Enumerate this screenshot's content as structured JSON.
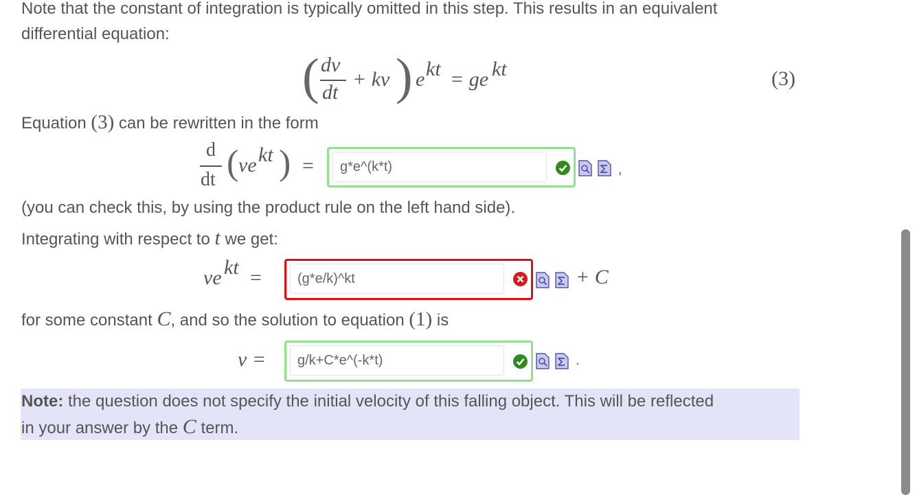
{
  "text": {
    "intro_line1": "Note that the constant of integration is typically omitted in this step. This results in an equivalent",
    "intro_line2": "differential equation:",
    "eq_number": "(3)",
    "equation_ref_prefix": "Equation",
    "equation_ref_num": "(3)",
    "equation_ref_suffix": "can be rewritten in the form",
    "check_note": "(you can check this, by using the product rule on the left hand side).",
    "integrating_prefix": "Integrating with respect to",
    "integrating_var": "t",
    "integrating_suffix": "we get:",
    "constant_prefix": "for some constant",
    "constant_var": "C",
    "constant_mid": ", and so the solution to equation",
    "constant_ref": "(1)",
    "constant_suffix": "is",
    "note_bold": "Note:",
    "note_line1": "the question does not specify the initial velocity of this falling object. This will be reflected",
    "note_line2_prefix": "in your answer by the",
    "note_line2_var": "C",
    "note_line2_suffix": "term."
  },
  "math": {
    "dv": "dv",
    "dt": "dt",
    "plus_kv": "+ kv",
    "e": "e",
    "kt": "kt",
    "equals_ge": "= ge",
    "d": "d",
    "ve": "ve",
    "equals": "=",
    "plus_C": "+ C",
    "v_equals": "v =",
    "comma": ",",
    "period": "."
  },
  "inputs": [
    {
      "value": "g*e^(k*t)",
      "status": "correct"
    },
    {
      "value": "(g*e/k)^kt",
      "status": "incorrect"
    },
    {
      "value": "g/k+C*e^(-k*t)",
      "status": "correct"
    }
  ],
  "icons": [
    "check-circle-icon",
    "cross-circle-icon",
    "preview-doc-icon",
    "sigma-doc-icon"
  ],
  "colors": {
    "correct_border": "#90e090",
    "incorrect_border": "#e01010",
    "correct_icon": "#2f8a1c",
    "incorrect_icon": "#d61b1b",
    "note_background": "#e4e4f8"
  }
}
